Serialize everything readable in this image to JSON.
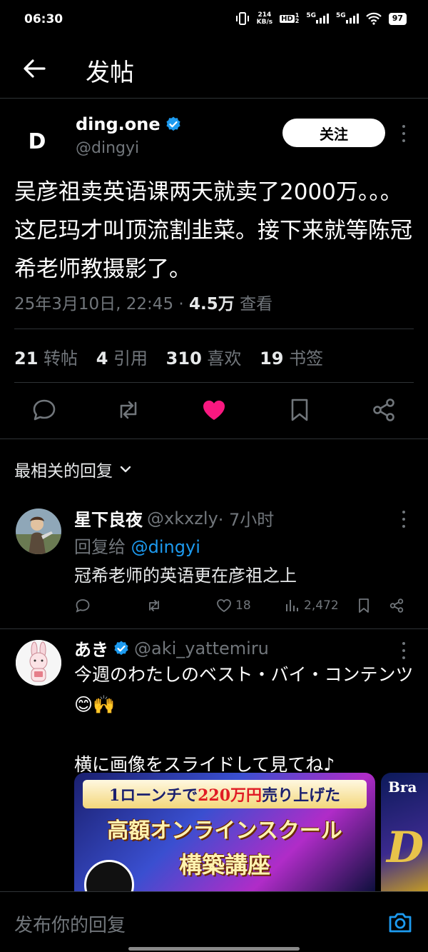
{
  "status_bar": {
    "time": "06:30",
    "net_speed_value": "214",
    "net_speed_unit": "KB/s",
    "hd_label": "HD",
    "hd_sub1": "1",
    "hd_sub2": "2",
    "net_gen_1": "5G",
    "net_gen_2": "5G",
    "battery": "97"
  },
  "app_bar": {
    "title": "发帖"
  },
  "tweet": {
    "author_name": "ding.one",
    "author_handle": "@dingyi",
    "avatar_letter": "D",
    "follow_label": "关注",
    "text": "吴彦祖卖英语课两天就卖了2000万。。。这尼玛才叫顶流割韭菜。接下来就等陈冠希老师教摄影了。",
    "timestamp": "25年3月10日, 22:45 · ",
    "views_count": "4.5万",
    "views_label": " 查看",
    "stats": {
      "reposts_count": "21",
      "reposts_label": "转帖",
      "quotes_count": "4",
      "quotes_label": "引用",
      "likes_count": "310",
      "likes_label": "喜欢",
      "bookmarks_count": "19",
      "bookmarks_label": "书签"
    }
  },
  "replies_sort": {
    "label": "最相关的回复"
  },
  "replies": [
    {
      "name": "星下良夜",
      "handle": "@xkxzly",
      "time": " · 7小时",
      "reply_to_label": "回复给 ",
      "reply_to_handle": "@dingyi",
      "text": "冠希老师的英语更在彦祖之上",
      "likes": "18",
      "views": "2,472"
    },
    {
      "name": "あき",
      "handle": "@aki_yattemiru",
      "text_line1": "今週のわたしのベスト・バイ・コンテンツ😊🙌",
      "text_line2": "横に画像をスライドして見てね♪",
      "media": {
        "banner_top_a": "1ローンチで",
        "banner_top_red": "220万円",
        "banner_top_b": "売り上げた",
        "headline_1": "高額オンラインスクール",
        "headline_2": "構築講座",
        "second_image_text": "Bra",
        "second_image_letter": "D"
      }
    }
  ],
  "composer": {
    "placeholder": "发布你的回复"
  },
  "colors": {
    "accent": "#1d9bf0",
    "like": "#f91880",
    "background": "#000000",
    "secondary_text": "#71767b"
  }
}
